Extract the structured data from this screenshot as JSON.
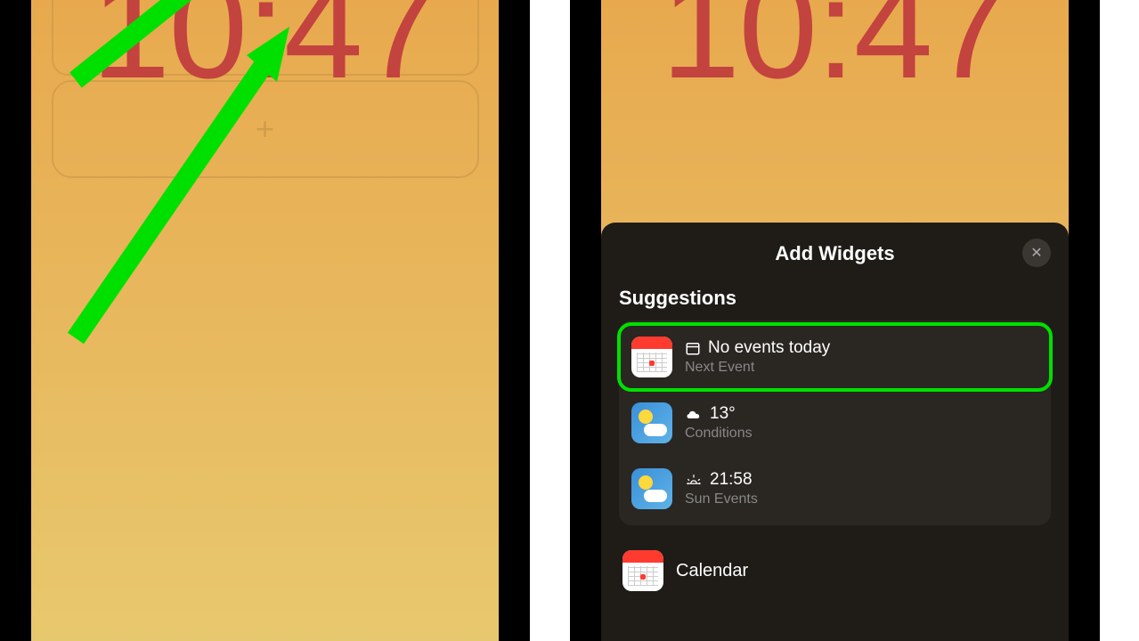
{
  "clock": {
    "time": "10:47"
  },
  "panel": {
    "title": "Add Widgets",
    "section": "Suggestions"
  },
  "suggestions": [
    {
      "title": "No events today",
      "subtitle": "Next Event",
      "icon": "calendar",
      "mini": "calendar-outline"
    },
    {
      "title": "13°",
      "subtitle": "Conditions",
      "icon": "weather",
      "mini": "cloud"
    },
    {
      "title": "21:58",
      "subtitle": "Sun Events",
      "icon": "weather",
      "mini": "sunrise"
    }
  ],
  "appList": [
    {
      "label": "Calendar",
      "icon": "calendar"
    }
  ],
  "icons": {
    "plus": "+",
    "close": "✕"
  }
}
